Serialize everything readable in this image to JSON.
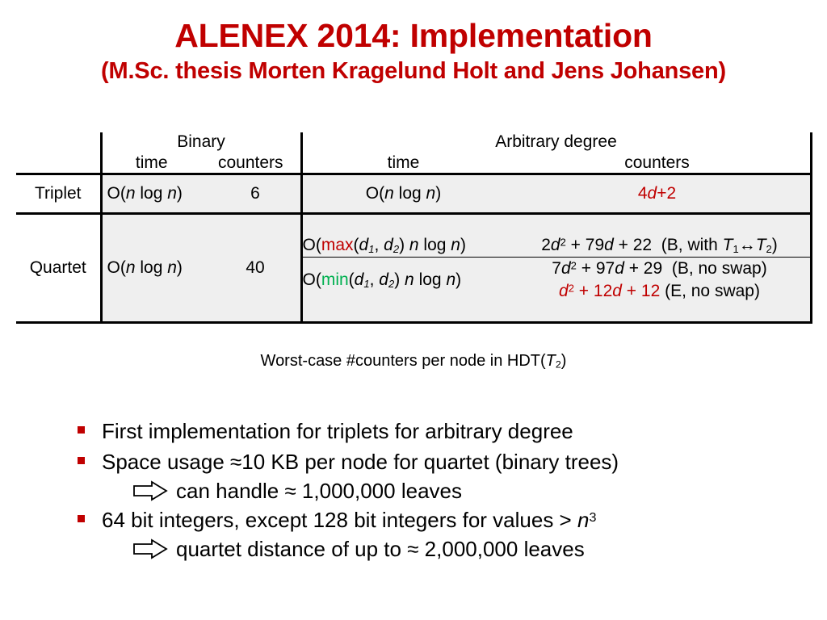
{
  "title": {
    "main": "ALENEX 2014: Implementation",
    "sub": "(M.Sc. thesis Morten Kragelund Holt and Jens Johansen)",
    "color": "#C00000"
  },
  "colors": {
    "accent_red": "#C00000",
    "accent_green": "#00B050",
    "shade": "#EFEFEF"
  },
  "table": {
    "group_headers": {
      "binary": "Binary",
      "arbitrary": "Arbitrary degree"
    },
    "sub_headers": {
      "binary_time": "time",
      "binary_counters": "counters",
      "arbitrary_time": "time",
      "arbitrary_counters": "counters"
    },
    "rows": [
      {
        "label": "Triplet",
        "binary_time": "O(n log n)",
        "binary_counters": "6",
        "arbitrary_time": "O(n log n)",
        "arbitrary_counters": "4d+2"
      },
      {
        "label": "Quartet",
        "binary_time": "O(n log n)",
        "binary_counters": "40",
        "arbitrary": [
          {
            "time_prefix": "O(",
            "time_func": "max",
            "time_suffix": "(d1, d2) n log n)",
            "counters": "2d2 + 79d + 22",
            "note": "(B, with T1↔T2)"
          },
          {
            "time_prefix": "O(",
            "time_func": "min",
            "time_suffix": "(d1, d2) n log n)",
            "counters": "7d2 + 97d + 29",
            "note": "(B, no swap)"
          },
          {
            "counters": "d2 + 12d + 12",
            "note": "(E, no swap)"
          }
        ]
      }
    ],
    "caption": "Worst-case #counters per node in HDT(T2)"
  },
  "bullets": [
    {
      "marker": "square-bullet",
      "text": "First implementation for triplets for arbitrary degree"
    },
    {
      "marker": "square-bullet",
      "text": "Space usage ≈10 KB per node for quartet (binary trees)",
      "sub": {
        "marker": "block-arrow-icon",
        "text": "can handle ≈ 1,000,000 leaves"
      }
    },
    {
      "marker": "square-bullet",
      "text": "64 bit integers, except 128 bit integers for values > n3",
      "sub": {
        "marker": "block-arrow-icon",
        "text": "quartet distance of up to ≈ 2,000,000 leaves"
      }
    }
  ]
}
